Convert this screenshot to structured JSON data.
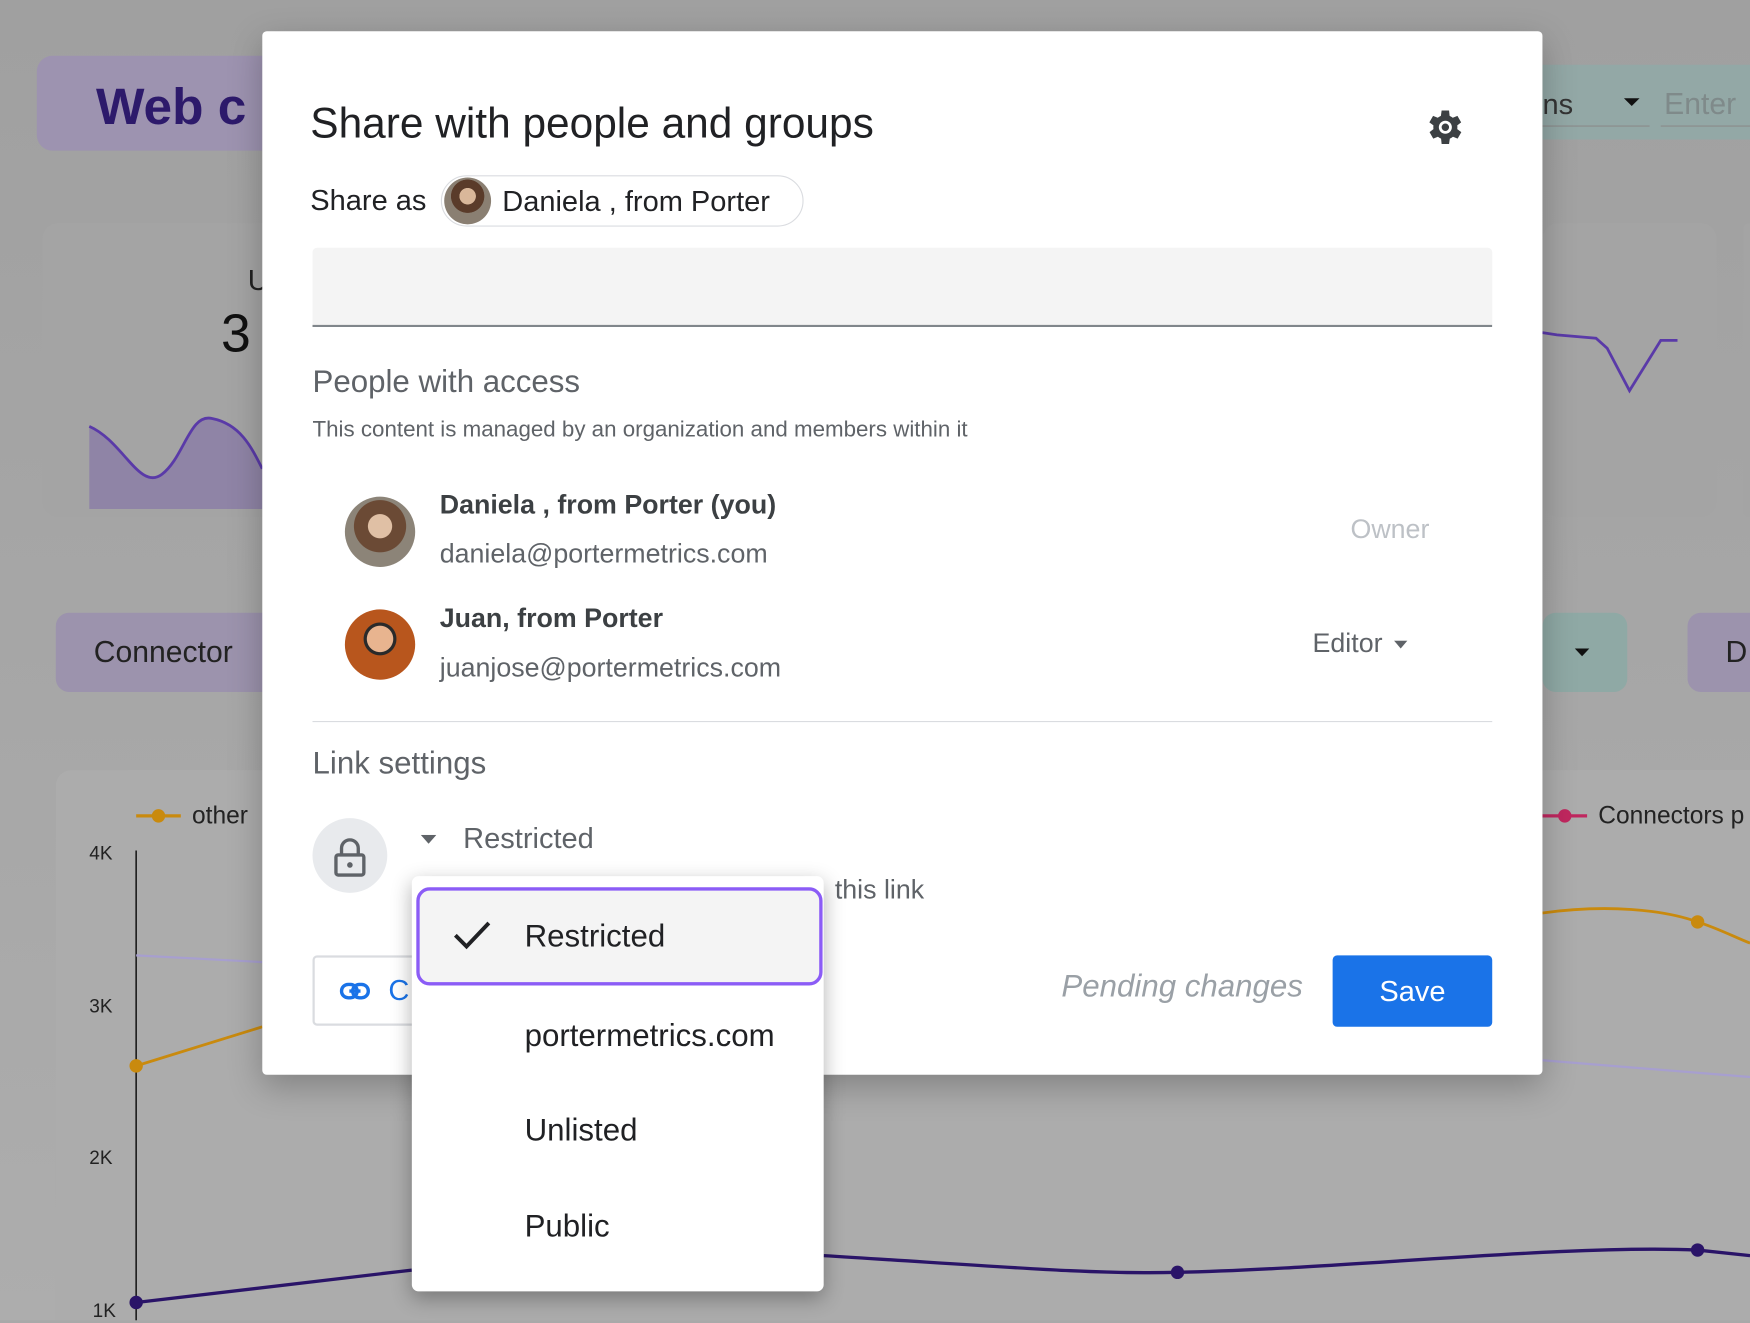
{
  "background": {
    "title_partial": "Web c",
    "card_label_partial": "U",
    "card_value_partial": "3",
    "filter_partial": "ns",
    "enter_placeholder": "Enter",
    "connector_label": "Connector",
    "right_pill_partial": "D",
    "chart": {
      "y_ticks": [
        "4K",
        "3K",
        "2K",
        "1K"
      ],
      "legend": [
        {
          "name": "other",
          "color": "#c98a0e"
        },
        {
          "name": "Connectors p",
          "color": "#c0275f"
        }
      ]
    }
  },
  "dialog": {
    "title": "Share with people and groups",
    "settings_icon": "gear-icon",
    "share_as_label": "Share as",
    "share_as_name": "Daniela , from Porter",
    "people_heading": "People with access",
    "people_subtitle": "This content is managed by an organization and members within it",
    "people": [
      {
        "name": "Daniela , from Porter (you)",
        "email": "daniela@portermetrics.com",
        "role": "Owner"
      },
      {
        "name": "Juan, from Porter",
        "email": "juanjose@portermetrics.com",
        "role": "Editor"
      }
    ],
    "link_heading": "Link settings",
    "link_access": "Restricted",
    "link_description_partial": "this link",
    "copy_button_partial": "C",
    "pending": "Pending changes",
    "save": "Save",
    "accent": "#1a73e8"
  },
  "dropdown": {
    "selected": "Restricted",
    "options": [
      "Restricted",
      "portermetrics.com",
      "Unlisted",
      "Public"
    ],
    "highlight_color": "#8b5cf6"
  }
}
